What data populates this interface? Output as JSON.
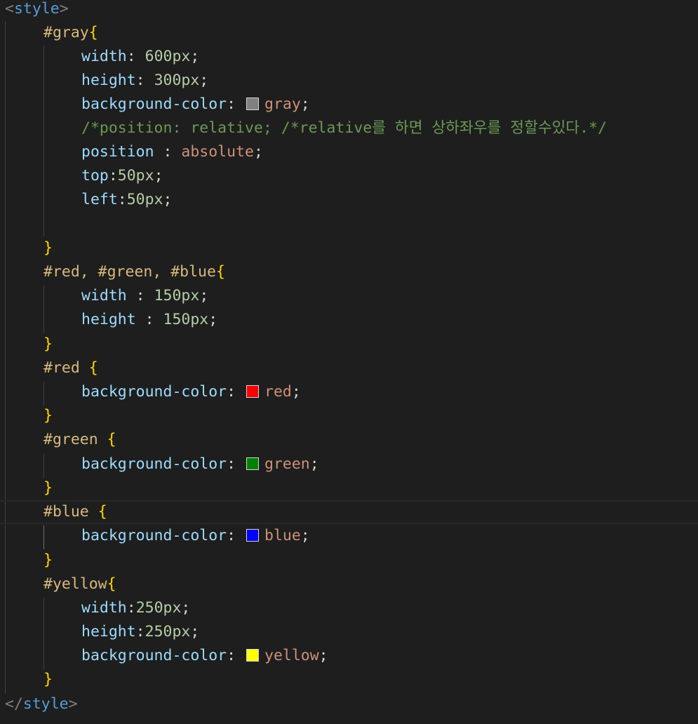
{
  "lines": {
    "open_tag": "style",
    "close_tag": "style",
    "gray_selector": "#gray",
    "gray_width_prop": "width",
    "gray_width_val": "600px",
    "gray_height_prop": "height",
    "gray_height_val": "300px",
    "gray_bg_prop": "background-color",
    "gray_bg_val": "gray",
    "gray_comment": "/*position: relative; /*relative를 하면 상하좌우를 정할수있다.*/",
    "gray_pos_prop": "position",
    "gray_pos_val": "absolute",
    "gray_top_prop": "top",
    "gray_top_val": "50px",
    "gray_left_prop": "left",
    "gray_left_val": "50px",
    "group_selector": "#red, #green, #blue",
    "group_width_prop": "width",
    "group_width_val": "150px",
    "group_height_prop": "height",
    "group_height_val": "150px",
    "red_selector": "#red",
    "red_bg_prop": "background-color",
    "red_bg_val": "red",
    "green_selector": "#green",
    "green_bg_prop": "background-color",
    "green_bg_val": "green",
    "blue_selector": "#blue",
    "blue_bg_prop": "background-color",
    "blue_bg_val": "blue",
    "yellow_selector": "#yellow",
    "yellow_width_prop": "width",
    "yellow_width_val": "250px",
    "yellow_height_prop": "height",
    "yellow_height_val": "250px",
    "yellow_bg_prop": "background-color",
    "yellow_bg_val": "yellow"
  },
  "swatch_colors": {
    "gray": "#808080",
    "red": "#ff0000",
    "green": "#008000",
    "blue": "#0000ff",
    "yellow": "#ffff00"
  }
}
